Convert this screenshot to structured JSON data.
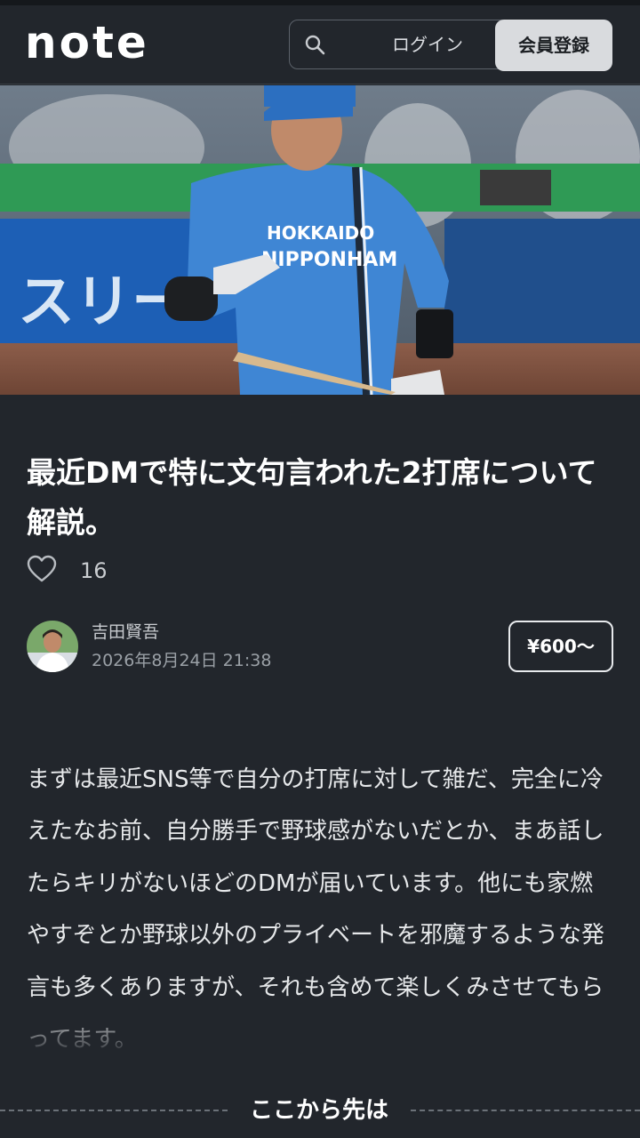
{
  "header": {
    "logo_text": "note",
    "login_label": "ログイン",
    "register_label": "会員登録",
    "search_icon": "search-icon"
  },
  "hero": {
    "jersey_text_line1": "HOKKAIDO",
    "jersey_text_line2": "NIPPONHAM",
    "banner_text": "スリー"
  },
  "article": {
    "title": "最近DMで特に文句言われた2打席について解説。",
    "like_count": "16",
    "author_name": "吉田賢吾",
    "published": "2026年8月24日 21:38",
    "price": "¥600〜",
    "body": "まずは最近SNS等で自分の打席に対して雑だ、完全に冷えたなお前、自分勝手で野球感がないだとか、まあ話したらキリがないほどのDMが届いています。他にも家燃やすぞとか野球以外のプライベートを邪魔するような発言も多くありますが、それも含めて楽しくみさせてもらってます。",
    "paywall_label": "ここから先は"
  },
  "colors": {
    "background": "#22262c",
    "jersey_blue": "#3f86d4",
    "register_bg": "#d9dbde"
  }
}
